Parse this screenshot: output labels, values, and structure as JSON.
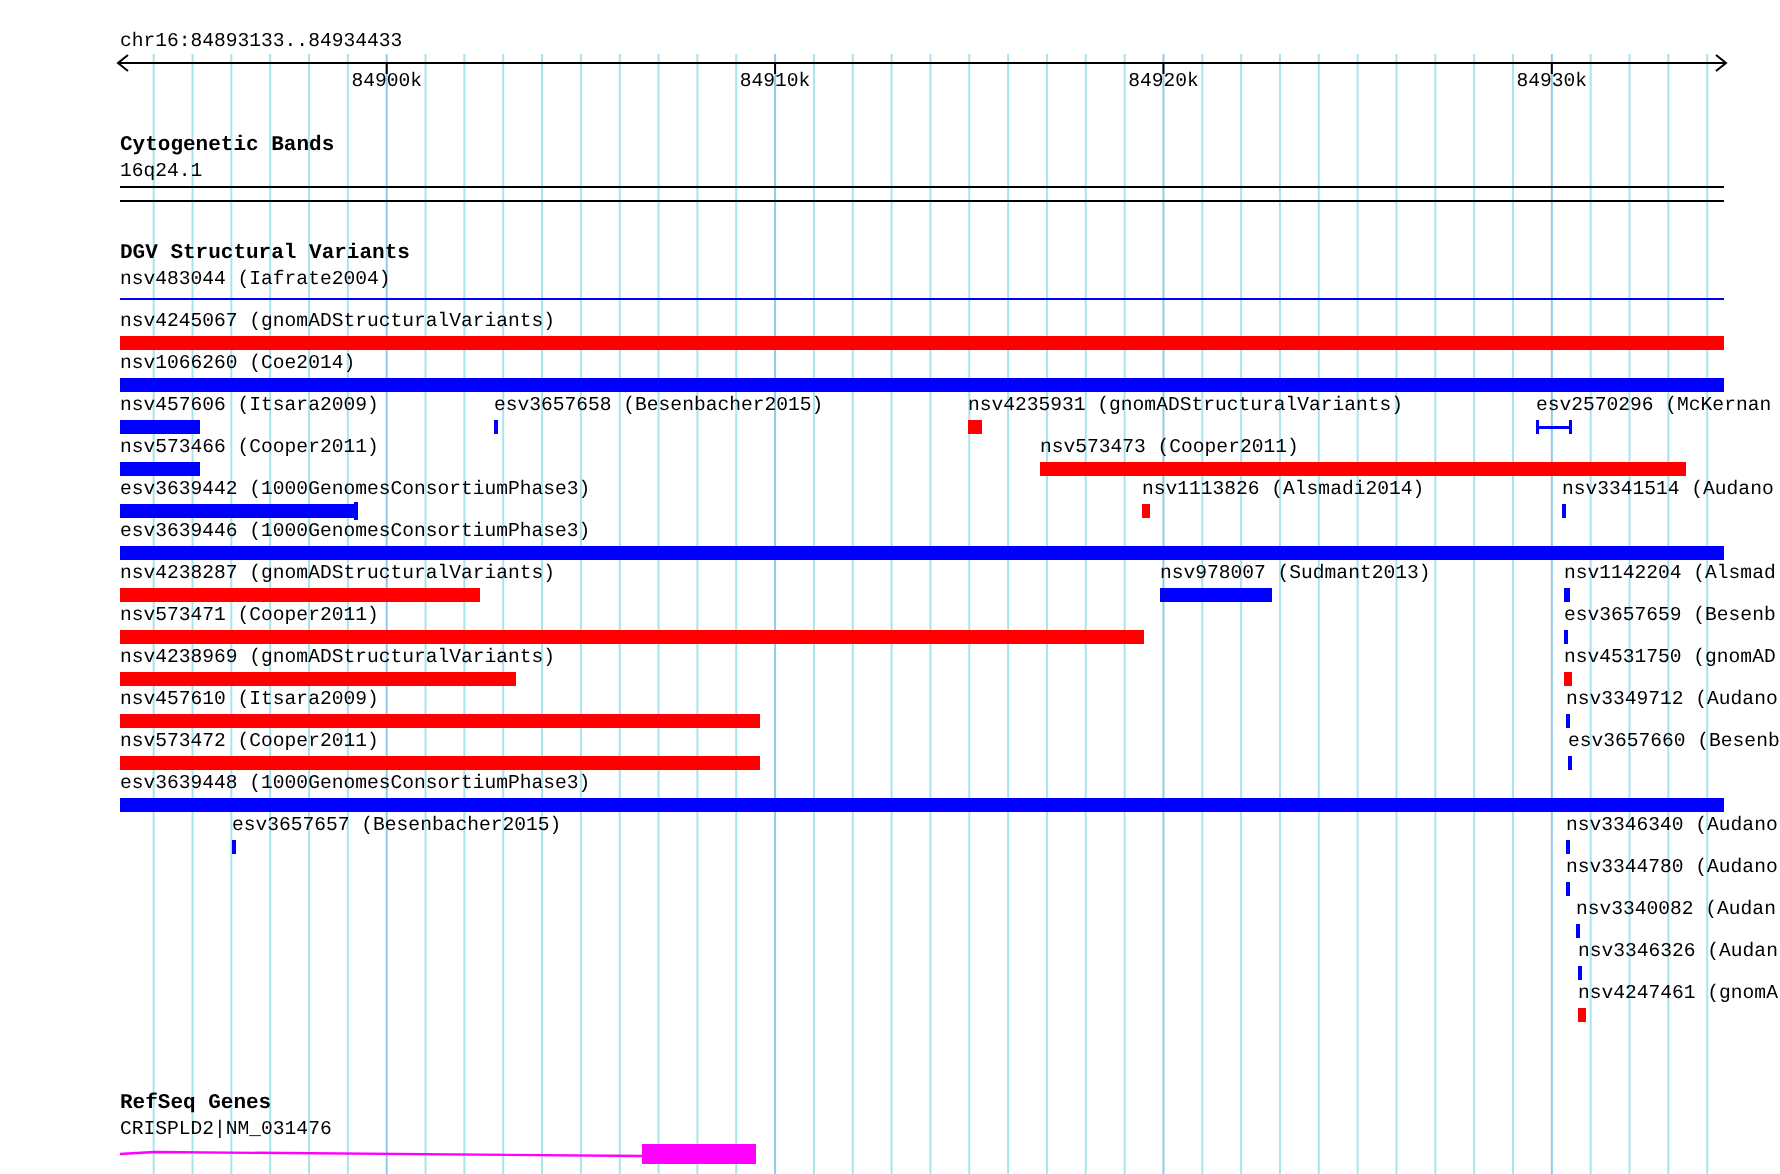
{
  "view": {
    "location": "chr16:84893133..84934433"
  },
  "ruler": {
    "ticks": [
      {
        "label": "84900k"
      },
      {
        "label": "84910k"
      },
      {
        "label": "84920k"
      },
      {
        "label": "84930k"
      }
    ]
  },
  "cytogenetic_bands": {
    "title": "Cytogenetic Bands",
    "band": "16q24.1"
  },
  "dgv": {
    "title": "DGV Structural Variants",
    "top_feature": {
      "label": "nsv483044 (Iafrate2004)",
      "kind": "line",
      "color": "#0000ff"
    },
    "lanes": [
      [
        {
          "label": "nsv4245067 (gnomADStructuralVariants)",
          "kind": "bar",
          "color": "#ff0000"
        }
      ],
      [
        {
          "label": "nsv1066260 (Coe2014)",
          "kind": "bar",
          "color": "#0000ff"
        }
      ],
      [
        {
          "label": "nsv457606 (Itsara2009)",
          "kind": "bar",
          "color": "#0000ff"
        },
        {
          "label": "esv3657658 (Besenbacher2015)",
          "kind": "bar",
          "color": "#0000ff"
        },
        {
          "label": "nsv4235931 (gnomADStructuralVariants)",
          "kind": "bar",
          "color": "#ff0000"
        },
        {
          "label": "esv2570296 (McKernan",
          "kind": "interval",
          "color": "#0000ff"
        }
      ],
      [
        {
          "label": "nsv573466 (Cooper2011)",
          "kind": "bar",
          "color": "#0000ff"
        },
        {
          "label": "nsv573473 (Cooper2011)",
          "kind": "bar",
          "color": "#ff0000"
        }
      ],
      [
        {
          "label": "esv3639442 (1000GenomesConsortiumPhase3)",
          "kind": "bar-capped",
          "color": "#0000ff"
        },
        {
          "label": "nsv1113826 (Alsmadi2014)",
          "kind": "bar",
          "color": "#ff0000"
        },
        {
          "label": "nsv3341514 (Audano",
          "kind": "bar",
          "color": "#0000ff"
        }
      ],
      [
        {
          "label": "esv3639446 (1000GenomesConsortiumPhase3)",
          "kind": "bar",
          "color": "#0000ff"
        }
      ],
      [
        {
          "label": "nsv4238287 (gnomADStructuralVariants)",
          "kind": "bar",
          "color": "#ff0000"
        },
        {
          "label": "nsv978007 (Sudmant2013)",
          "kind": "bar",
          "color": "#0000ff"
        },
        {
          "label": "nsv1142204 (Alsmad",
          "kind": "bar",
          "color": "#0000ff"
        }
      ],
      [
        {
          "label": "nsv573471 (Cooper2011)",
          "kind": "bar",
          "color": "#ff0000"
        },
        {
          "label": "esv3657659 (Besenb",
          "kind": "bar",
          "color": "#0000ff"
        }
      ],
      [
        {
          "label": "nsv4238969 (gnomADStructuralVariants)",
          "kind": "bar",
          "color": "#ff0000"
        },
        {
          "label": "nsv4531750 (gnomAD",
          "kind": "bar",
          "color": "#ff0000"
        }
      ],
      [
        {
          "label": "nsv457610 (Itsara2009)",
          "kind": "bar",
          "color": "#ff0000"
        },
        {
          "label": "nsv3349712 (Audano",
          "kind": "bar",
          "color": "#0000ff"
        }
      ],
      [
        {
          "label": "nsv573472 (Cooper2011)",
          "kind": "bar",
          "color": "#ff0000"
        },
        {
          "label": "esv3657660 (Besenb",
          "kind": "bar",
          "color": "#0000ff"
        }
      ],
      [
        {
          "label": "esv3639448 (1000GenomesConsortiumPhase3)",
          "kind": "bar",
          "color": "#0000ff"
        }
      ],
      [
        {
          "label": "esv3657657 (Besenbacher2015)",
          "kind": "bar",
          "color": "#0000ff"
        },
        {
          "label": "nsv3346340 (Audano",
          "kind": "bar",
          "color": "#0000ff"
        }
      ],
      [
        {
          "label": "nsv3344780 (Audano",
          "kind": "bar",
          "color": "#0000ff"
        }
      ],
      [
        {
          "label": "nsv3340082 (Audan",
          "kind": "bar",
          "color": "#0000ff"
        }
      ],
      [
        {
          "label": "nsv3346326 (Audan",
          "kind": "bar",
          "color": "#0000ff"
        }
      ],
      [
        {
          "label": "nsv4247461 (gnomA",
          "kind": "bar",
          "color": "#ff0000"
        }
      ]
    ]
  },
  "refseq": {
    "title": "RefSeq Genes",
    "gene": {
      "label": "CRISPLD2|NM_031476"
    }
  }
}
